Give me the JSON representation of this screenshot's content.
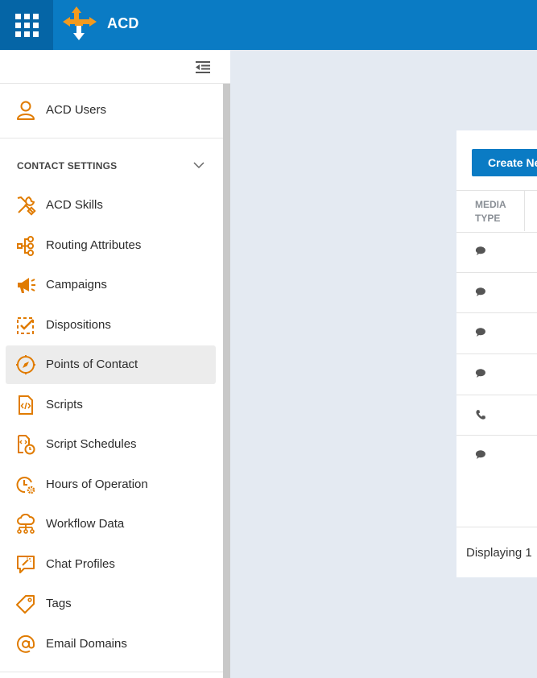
{
  "header": {
    "app_title": "ACD",
    "apps_icon": "apps-grid-icon",
    "logo_icon": "acd-arrows-logo",
    "brand_color": "#0a7bc4"
  },
  "sidebar": {
    "collapse_icon": "collapse-menu-icon",
    "top_item": {
      "label": "ACD Users",
      "icon": "user-icon"
    },
    "section": {
      "title": "CONTACT SETTINGS",
      "icon": "chevron-down-icon"
    },
    "items": [
      {
        "label": "ACD Skills",
        "icon": "tools-icon"
      },
      {
        "label": "Routing Attributes",
        "icon": "routing-icon"
      },
      {
        "label": "Campaigns",
        "icon": "megaphone-icon"
      },
      {
        "label": "Dispositions",
        "icon": "checkbox-icon"
      },
      {
        "label": "Points of Contact",
        "icon": "compass-icon",
        "active": true
      },
      {
        "label": "Scripts",
        "icon": "script-icon"
      },
      {
        "label": "Script Schedules",
        "icon": "script-schedule-icon"
      },
      {
        "label": "Hours of Operation",
        "icon": "clock-gear-icon"
      },
      {
        "label": "Workflow Data",
        "icon": "cloud-network-icon"
      },
      {
        "label": "Chat Profiles",
        "icon": "chat-profile-icon"
      },
      {
        "label": "Tags",
        "icon": "tag-icon"
      },
      {
        "label": "Email Domains",
        "icon": "at-sign-icon"
      }
    ],
    "accent_color": "#e07b00"
  },
  "main": {
    "create_button_label": "Create Ne",
    "table": {
      "column_header": "MEDIA TYPE",
      "rows": [
        {
          "media_icon": "chat-bubble-icon"
        },
        {
          "media_icon": "chat-bubble-icon"
        },
        {
          "media_icon": "chat-bubble-icon"
        },
        {
          "media_icon": "chat-bubble-icon"
        },
        {
          "media_icon": "phone-icon"
        },
        {
          "media_icon": "chat-bubble-icon"
        }
      ]
    },
    "footer_text": "Displaying 1"
  }
}
